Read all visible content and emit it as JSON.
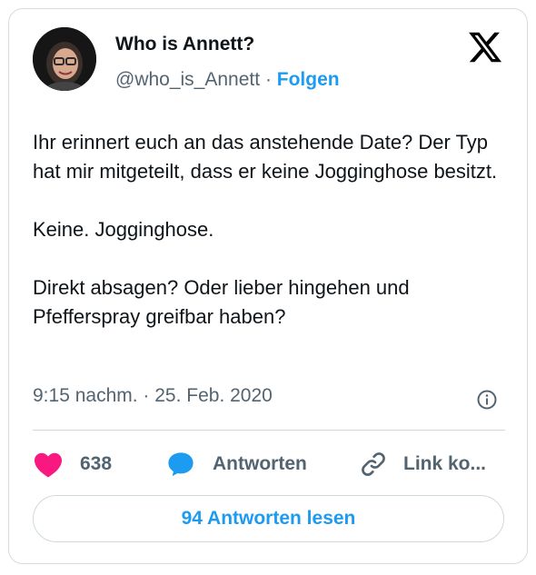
{
  "author": {
    "name": "Who is Annett?",
    "handle": "@who_is_Annett",
    "separator": "·",
    "follow_label": "Folgen"
  },
  "tweet": {
    "paragraphs": [
      "Ihr erinnert euch an das anstehende Date? Der Typ hat mir mitgeteilt, dass er keine Jogginghose besitzt.",
      "Keine. Jogginghose.",
      "Direkt absagen? Oder lieber hingehen und Pfefferspray greifbar haben?"
    ],
    "timestamp": "9:15 nachm. · 25. Feb. 2020"
  },
  "actions": {
    "like_count": "638",
    "reply_label": "Antworten",
    "copy_link_label": "Link ko..."
  },
  "read_replies_label": "94 Antworten lesen",
  "icons": [
    "x-logo-icon",
    "info-icon",
    "heart-icon",
    "reply-bubble-icon",
    "link-icon"
  ],
  "colors": {
    "accent": "#1d9bf0",
    "heart": "#f91880",
    "text": "#0f1419",
    "secondary": "#536471"
  }
}
